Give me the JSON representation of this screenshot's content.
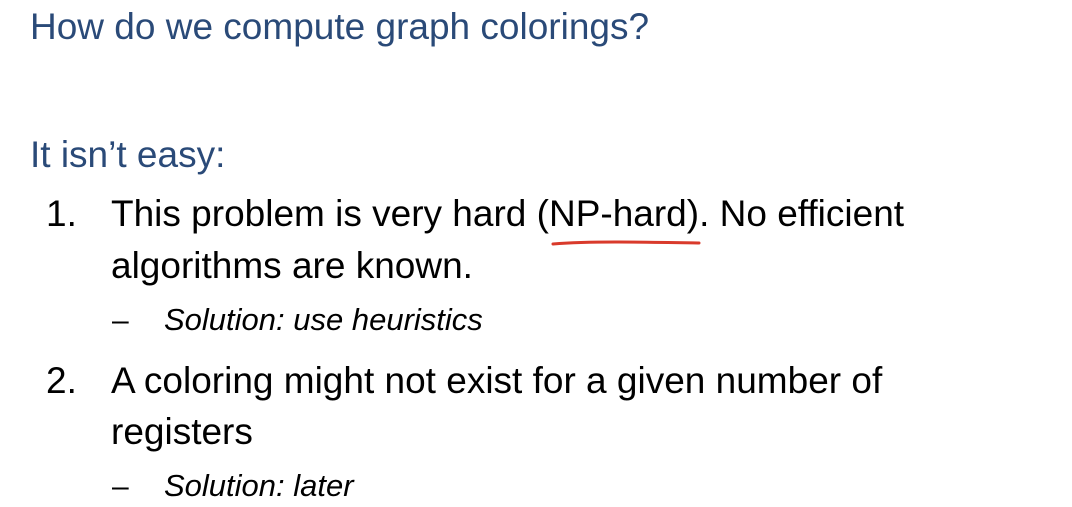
{
  "slide": {
    "title": "How do we compute graph colorings?",
    "intro": "It isn’t easy:",
    "items": [
      {
        "number": "1.",
        "line1_before": "This problem is very hard (",
        "line1_marked": "NP-hard",
        "line1_after": "). No efficient",
        "line2": "algorithms are known.",
        "dash": "–",
        "subpoint": "Solution: use heuristics"
      },
      {
        "number": "2.",
        "line1": "A coloring might not exist for a given number of",
        "line2": "registers",
        "dash": "–",
        "subpoint": "Solution: later"
      }
    ]
  },
  "colors": {
    "title": "#2a4a78",
    "body": "#000000",
    "annotation": "#d93a2b"
  }
}
